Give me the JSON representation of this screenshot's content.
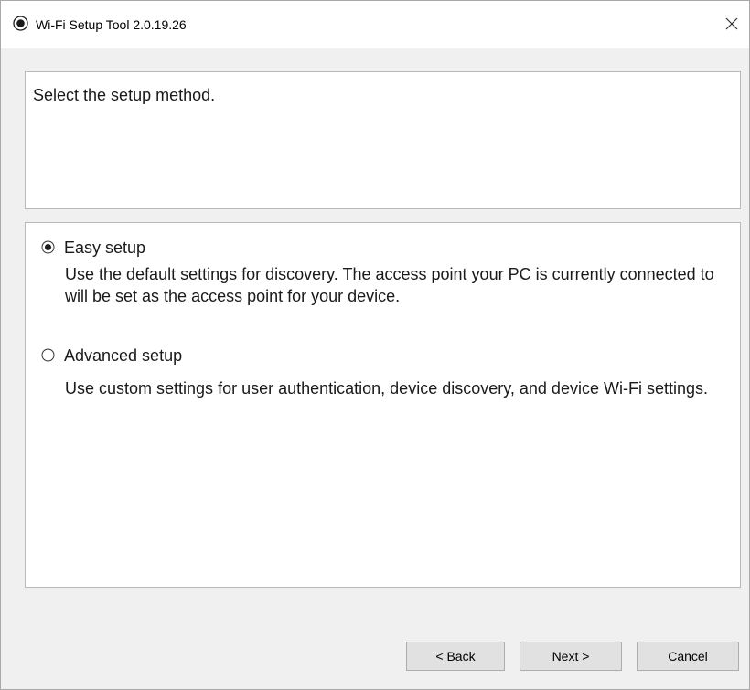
{
  "window": {
    "title": "Wi-Fi Setup Tool 2.0.19.26",
    "close_glyph": "✕",
    "icon": "app-icon",
    "close_icon": "close-icon"
  },
  "header": {
    "instruction": "Select the setup method."
  },
  "options": [
    {
      "label": "Easy setup",
      "selected": true,
      "description": "Use the default settings for discovery. The access point your PC is currently connected to will be set as the access point for your device."
    },
    {
      "label": "Advanced setup",
      "selected": false,
      "description": "Use custom settings for user authentication, device discovery, and device Wi-Fi settings."
    }
  ],
  "buttons": {
    "back": "< Back",
    "next": "Next >",
    "cancel": "Cancel"
  },
  "colors": {
    "window_background": "#f0f0f0",
    "panel_background": "#ffffff",
    "panel_border": "#b9b9b9",
    "button_background": "#e1e1e1",
    "button_border": "#adadad"
  }
}
